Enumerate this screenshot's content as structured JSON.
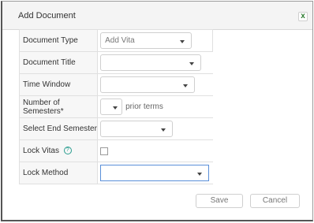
{
  "dialog": {
    "title": "Add Document",
    "close_glyph": "x"
  },
  "form": {
    "document_type": {
      "label": "Document Type",
      "value": "Add Vita"
    },
    "document_title": {
      "label": "Document Title",
      "value": ""
    },
    "time_window": {
      "label": "Time Window",
      "value": ""
    },
    "number_of_semesters": {
      "label": "Number of Semesters*",
      "value": "",
      "suffix": "prior terms"
    },
    "select_end_semester": {
      "label": "Select End Semester",
      "value": ""
    },
    "lock_vitas": {
      "label": "Lock Vitas",
      "help_glyph": "?",
      "checked": false
    },
    "lock_method": {
      "label": "Lock Method",
      "value": ""
    }
  },
  "buttons": {
    "save": "Save",
    "cancel": "Cancel"
  },
  "colors": {
    "accent_green": "#2e7d32",
    "help_teal": "#2a9d8f",
    "focus_blue": "#5a8fd8"
  }
}
